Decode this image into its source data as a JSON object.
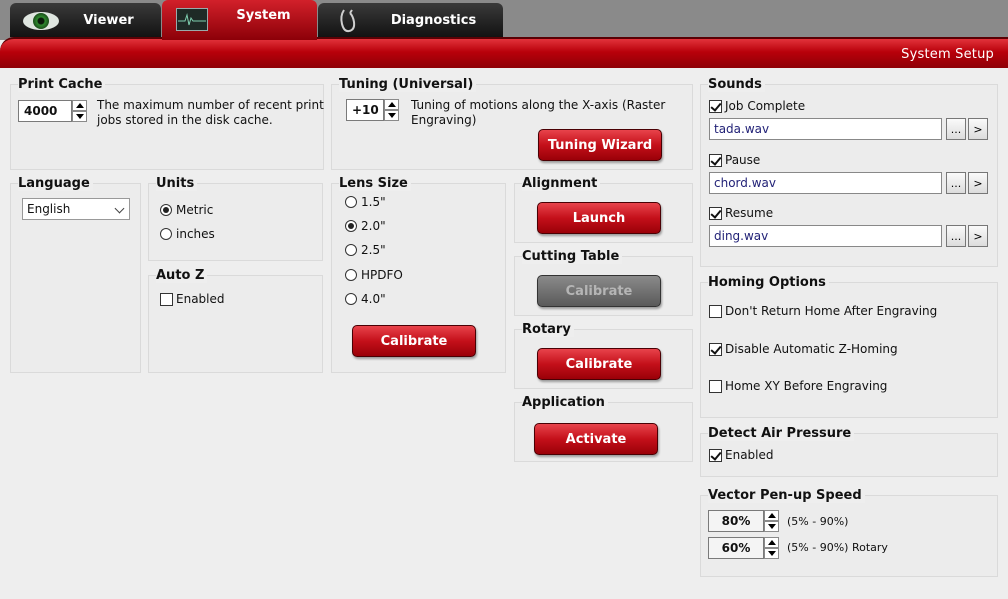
{
  "tabs": [
    {
      "label": "Viewer",
      "icon": "eye-icon"
    },
    {
      "label": "System",
      "icon": "monitor-icon",
      "active": true
    },
    {
      "label": "Diagnostics",
      "icon": "hook-icon"
    }
  ],
  "header": {
    "title": "System Setup"
  },
  "colors": {
    "accent_red": "#c4101a",
    "tab_dark": "#1c1c1c",
    "background": "#eeeeee"
  },
  "print_cache": {
    "title": "Print Cache",
    "value": "4000",
    "description_line1": "The maximum number of recent print",
    "description_line2": "jobs stored in the disk cache."
  },
  "tuning": {
    "title": "Tuning (Universal)",
    "value": "+10",
    "description_line1": "Tuning of motions along the X-axis (Raster",
    "description_line2": "Engraving)",
    "wizard_button": "Tuning Wizard"
  },
  "language": {
    "title": "Language",
    "selected": "English"
  },
  "units": {
    "title": "Units",
    "options": [
      "Metric",
      "inches"
    ],
    "selected": "Metric"
  },
  "auto_z": {
    "title": "Auto Z",
    "checkbox_label": "Enabled",
    "checked": false
  },
  "lens_size": {
    "title": "Lens Size",
    "options": [
      "1.5\"",
      "2.0\"",
      "2.5\"",
      "HPDFO",
      "4.0\""
    ],
    "selected": "2.0\"",
    "calibrate_button": "Calibrate"
  },
  "alignment": {
    "title": "Alignment",
    "button": "Launch"
  },
  "cutting_table": {
    "title": "Cutting Table",
    "button": "Calibrate",
    "button_disabled": true
  },
  "rotary": {
    "title": "Rotary",
    "button": "Calibrate"
  },
  "application": {
    "title": "Application",
    "button": "Activate"
  },
  "sounds": {
    "title": "Sounds",
    "items": [
      {
        "label": "Job Complete",
        "checked": true,
        "file": "tada.wav"
      },
      {
        "label": "Pause",
        "checked": true,
        "file": "chord.wav"
      },
      {
        "label": "Resume",
        "checked": true,
        "file": "ding.wav"
      }
    ],
    "browse_label": "...",
    "play_label": ">"
  },
  "homing_options": {
    "title": "Homing Options",
    "items": [
      {
        "label": "Don't Return Home After Engraving",
        "checked": false
      },
      {
        "label": "Disable Automatic Z-Homing",
        "checked": true
      },
      {
        "label": "Home XY Before Engraving",
        "checked": false
      }
    ]
  },
  "detect_air_pressure": {
    "title": "Detect Air Pressure",
    "checkbox_label": "Enabled",
    "checked": true
  },
  "vector_pen_up_speed": {
    "title": "Vector Pen-up Speed",
    "rows": [
      {
        "value": "80%",
        "range_label": "(5% - 90%)"
      },
      {
        "value": "60%",
        "range_label": "(5% - 90%) Rotary"
      }
    ]
  }
}
